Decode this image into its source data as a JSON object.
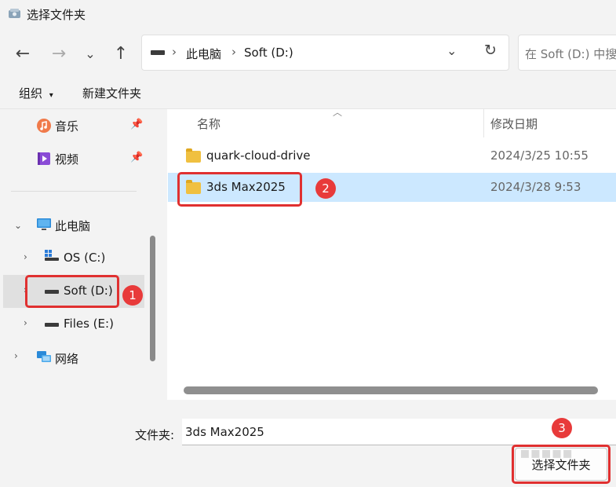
{
  "window": {
    "title": "选择文件夹"
  },
  "navigation": {
    "breadcrumb": [
      "此电脑",
      "Soft (D:)"
    ],
    "search_placeholder": "在 Soft (D:) 中搜"
  },
  "toolbar": {
    "organize_label": "组织",
    "new_folder_label": "新建文件夹"
  },
  "sidebar": {
    "quick_access": [
      {
        "label": "音乐",
        "icon": "music-icon"
      },
      {
        "label": "视频",
        "icon": "video-icon"
      }
    ],
    "this_pc_label": "此电脑",
    "drives": [
      {
        "label": "OS (C:)"
      },
      {
        "label": "Soft (D:)",
        "selected": true
      },
      {
        "label": "Files (E:)"
      }
    ],
    "network_label": "网络"
  },
  "file_list": {
    "columns": {
      "name": "名称",
      "modified": "修改日期"
    },
    "rows": [
      {
        "name": "quark-cloud-drive",
        "modified": "2024/3/25 10:55",
        "selected": false
      },
      {
        "name": "3ds Max2025",
        "modified": "2024/3/28 9:53",
        "selected": true
      }
    ]
  },
  "footer": {
    "folder_label": "文件夹:",
    "folder_value": "3ds Max2025",
    "select_button_label": "选择文件夹"
  },
  "annotations": {
    "step1": "1",
    "step2": "2",
    "step3": "3"
  },
  "colors": {
    "annotation": "#e03030",
    "selection": "#cce8ff",
    "folder": "#f0c040"
  }
}
